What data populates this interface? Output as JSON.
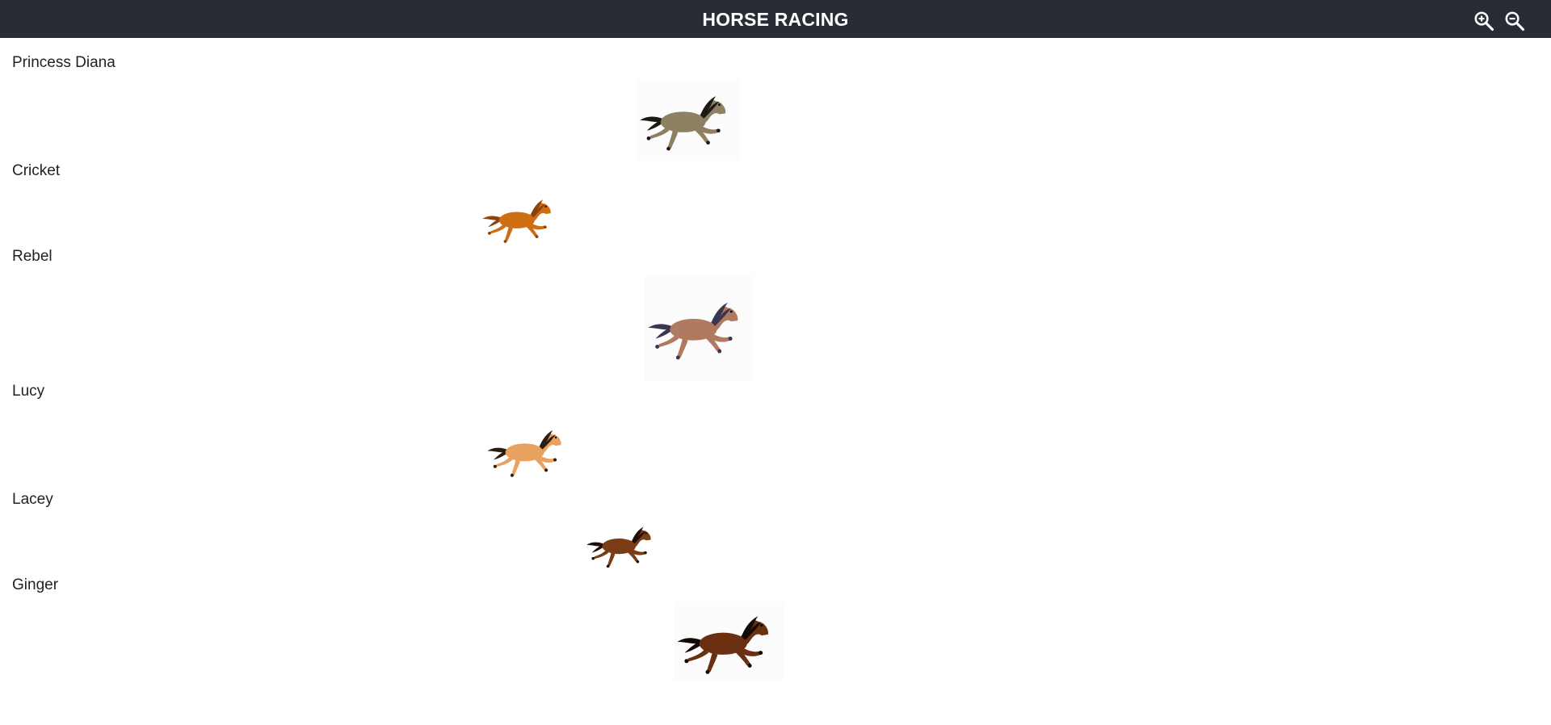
{
  "header": {
    "title": "HORSE RACING",
    "zoom_in_icon": "zoom-in-icon",
    "zoom_out_icon": "zoom-out-icon"
  },
  "horses": [
    {
      "name": "Princess Diana",
      "coat": "#8f7f63",
      "mane": "#1d1a16",
      "icon": "horse-icon"
    },
    {
      "name": "Cricket",
      "coat": "#cf6d12",
      "mane": "#8a4310",
      "icon": "horse-icon"
    },
    {
      "name": "Rebel",
      "coat": "#b07a60",
      "mane": "#3a3550",
      "icon": "horse-icon"
    },
    {
      "name": "Lucy",
      "coat": "#e8a15e",
      "mane": "#2a1d12",
      "icon": "horse-icon"
    },
    {
      "name": "Lacey",
      "coat": "#7a3d16",
      "mane": "#1b0f08",
      "icon": "horse-icon"
    },
    {
      "name": "Ginger",
      "coat": "#6b2f12",
      "mane": "#140a05",
      "icon": "horse-icon"
    }
  ]
}
